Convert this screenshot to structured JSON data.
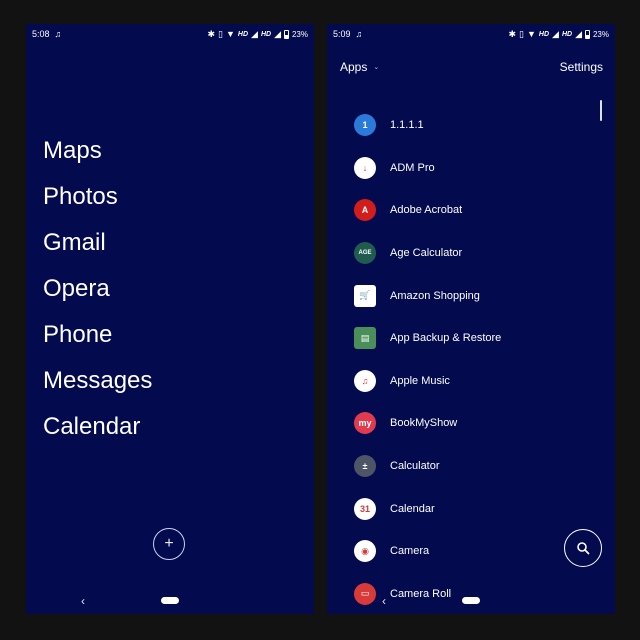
{
  "left_screen": {
    "status": {
      "time": "5:08",
      "battery": "23%",
      "hd1": "HD",
      "hd2": "HD"
    },
    "favorites": [
      "Maps",
      "Photos",
      "Gmail",
      "Opera",
      "Phone",
      "Messages",
      "Calendar"
    ],
    "add_label": "+",
    "nav": {
      "back": "‹"
    }
  },
  "right_screen": {
    "status": {
      "time": "5:09",
      "battery": "23%",
      "hd1": "HD",
      "hd2": "HD"
    },
    "header": {
      "apps_label": "Apps",
      "settings_label": "Settings"
    },
    "apps": [
      {
        "name": "1.1.1.1",
        "icon": "cloudflare-1111-icon",
        "color": "#2b7ad9",
        "glyph": "1"
      },
      {
        "name": "ADM Pro",
        "icon": "adm-pro-icon",
        "color": "#ffffff",
        "glyph": "↓"
      },
      {
        "name": "Adobe Acrobat",
        "icon": "adobe-acrobat-icon",
        "color": "#d21d1d",
        "glyph": "A"
      },
      {
        "name": "Age Calculator",
        "icon": "age-calculator-icon",
        "color": "#1f5c4f",
        "glyph": "AGE"
      },
      {
        "name": "Amazon Shopping",
        "icon": "amazon-shopping-icon",
        "color": "#ffffff",
        "glyph": "🛒"
      },
      {
        "name": "App Backup & Restore",
        "icon": "app-backup-icon",
        "color": "#4a8f5a",
        "glyph": "▤"
      },
      {
        "name": "Apple Music",
        "icon": "apple-music-icon",
        "color": "#ffffff",
        "glyph": "♫"
      },
      {
        "name": "BookMyShow",
        "icon": "bookmyshow-icon",
        "color": "#e23a4f",
        "glyph": "my"
      },
      {
        "name": "Calculator",
        "icon": "calculator-icon",
        "color": "#4e5566",
        "glyph": "±"
      },
      {
        "name": "Calendar",
        "icon": "calendar-icon",
        "color": "#ffffff",
        "glyph": "31"
      },
      {
        "name": "Camera",
        "icon": "camera-icon",
        "color": "#ffffff",
        "glyph": "◉"
      },
      {
        "name": "Camera Roll",
        "icon": "camera-roll-icon",
        "color": "#d83a3a",
        "glyph": "▭"
      }
    ],
    "nav": {
      "back": "‹"
    }
  }
}
